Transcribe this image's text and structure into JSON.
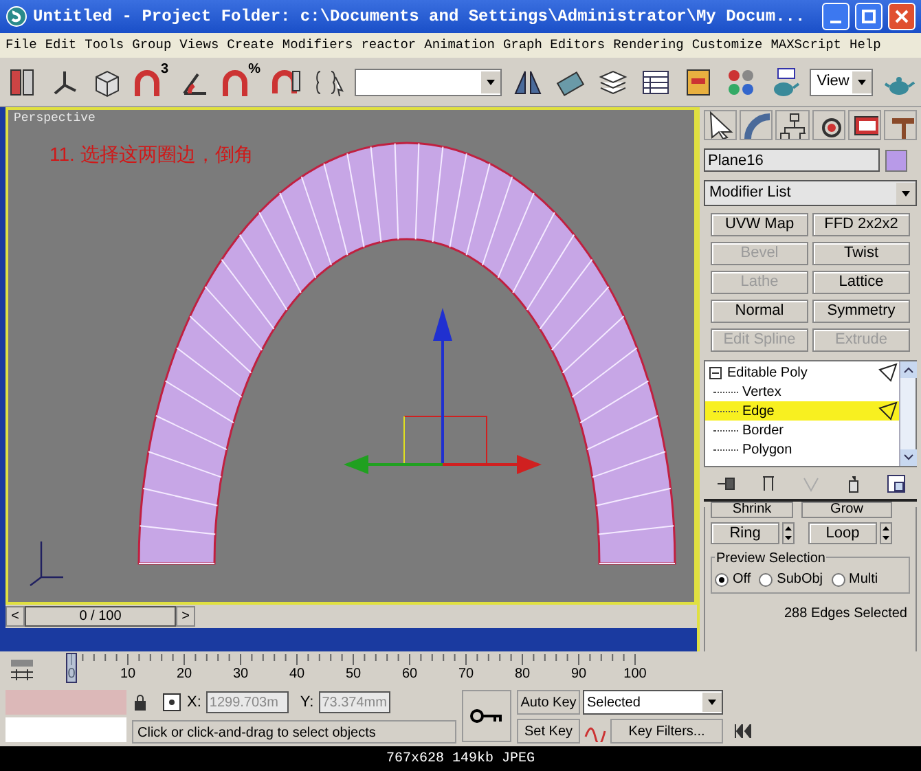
{
  "window": {
    "title": "Untitled   - Project Folder: c:\\Documents and Settings\\Administrator\\My Docum..."
  },
  "menu": [
    "File",
    "Edit",
    "Tools",
    "Group",
    "Views",
    "Create",
    "Modifiers",
    "reactor",
    "Animation",
    "Graph Editors",
    "Rendering",
    "Customize",
    "MAXScript",
    "Help"
  ],
  "toolbar": {
    "snap_marks": [
      "3",
      "%"
    ],
    "reference_coord": "View"
  },
  "viewport": {
    "label": "Perspective",
    "annotation": "11. 选择这两圈边，倒角"
  },
  "time_slider": {
    "prev": "<",
    "position": "0 / 100",
    "next": ">"
  },
  "timeline": {
    "ticks": [
      "0",
      "10",
      "20",
      "30",
      "40",
      "50",
      "60",
      "70",
      "80",
      "90",
      "100"
    ]
  },
  "command_panel": {
    "object_name": "Plane16",
    "modifier_list": "Modifier List",
    "modifier_buttons": [
      {
        "label": "UVW Map",
        "disabled": false
      },
      {
        "label": "FFD 2x2x2",
        "disabled": false
      },
      {
        "label": "Bevel",
        "disabled": true
      },
      {
        "label": "Twist",
        "disabled": false
      },
      {
        "label": "Lathe",
        "disabled": true
      },
      {
        "label": "Lattice",
        "disabled": false
      },
      {
        "label": "Normal",
        "disabled": false
      },
      {
        "label": "Symmetry",
        "disabled": false
      },
      {
        "label": "Edit Spline",
        "disabled": true
      },
      {
        "label": "Extrude",
        "disabled": true
      }
    ],
    "stack": [
      {
        "label": "Editable Poly",
        "selected": false,
        "expanded": true,
        "children": [
          {
            "label": "Vertex",
            "selected": false
          },
          {
            "label": "Edge",
            "selected": true
          },
          {
            "label": "Border",
            "selected": false
          },
          {
            "label": "Polygon",
            "selected": false
          }
        ]
      }
    ],
    "selection": {
      "shrink": "Shrink",
      "grow": "Grow",
      "ring": "Ring",
      "loop": "Loop",
      "preview_label": "Preview Selection",
      "preview_options": [
        {
          "label": "Off",
          "selected": true
        },
        {
          "label": "SubObj",
          "selected": false
        },
        {
          "label": "Multi",
          "selected": false
        }
      ],
      "status": "288 Edges Selected"
    }
  },
  "status": {
    "x_label": "X:",
    "x_value": "1299.703m",
    "y_label": "Y:",
    "y_value": "73.374mm",
    "prompt": "Click or click-and-drag to select objects",
    "auto_key": "Auto Key",
    "key_mode": "Selected",
    "set_key": "Set Key",
    "key_filters": "Key Filters..."
  },
  "image_info": "767x628 149kb JPEG"
}
